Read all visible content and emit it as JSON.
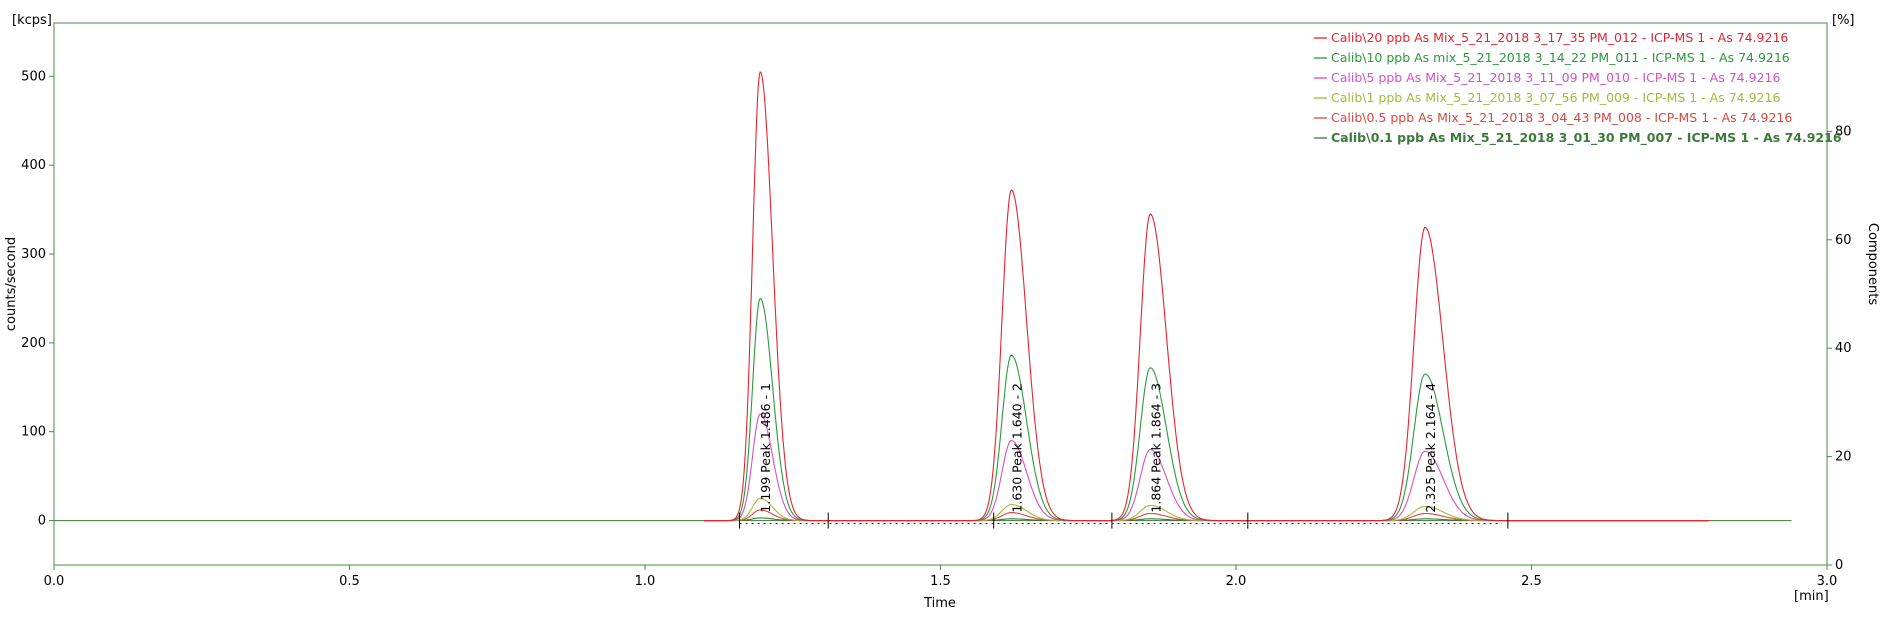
{
  "chart_data": {
    "type": "line",
    "xlabel": "Time",
    "x_unit": "[min]",
    "ylabel": "counts/second",
    "y_unit": "[kcps]",
    "y2label": "Components",
    "y2_unit": "[%]",
    "xlim": [
      0.0,
      3.0
    ],
    "ylim": [
      -50,
      560
    ],
    "y2lim": [
      0,
      100
    ],
    "x_ticks": [
      "0.0",
      "0.5",
      "1.0",
      "1.5",
      "2.0",
      "2.5",
      "3.0"
    ],
    "y_ticks": [
      "0",
      "100",
      "200",
      "300",
      "400",
      "500"
    ],
    "y2_ticks": [
      "0",
      "20",
      "40",
      "60",
      "80"
    ],
    "grid": false,
    "legend_position": "top-right",
    "peaks": [
      {
        "rt": 1.195,
        "label": "1.199 Peak 1.486 - 1",
        "width": 0.013
      },
      {
        "rt": 1.62,
        "label": "1.630 Peak 1.640 - 2",
        "width": 0.016
      },
      {
        "rt": 1.855,
        "label": "1.864 Peak 1.864 - 3",
        "width": 0.017
      },
      {
        "rt": 2.32,
        "label": "2.325 Peak 2.164 - 4",
        "width": 0.019
      }
    ],
    "series": [
      {
        "name": "Calib\\20 ppb As Mix_5_21_2018 3_17_35 PM_012 - ICP-MS 1 - As 74.9216",
        "color": "#e8232f",
        "bold": false,
        "heights": [
          505,
          372,
          345,
          330
        ]
      },
      {
        "name": "Calib\\10 ppb As mix_5_21_2018 3_14_22 PM_011 - ICP-MS 1 - As 74.9216",
        "color": "#2a9a3a",
        "bold": false,
        "heights": [
          250,
          186,
          172,
          165
        ]
      },
      {
        "name": "Calib\\5 ppb  As Mix_5_21_2018 3_11_09 PM_010 - ICP-MS 1 - As 74.9216",
        "color": "#d94fc0",
        "bold": false,
        "heights": [
          120,
          90,
          80,
          78
        ]
      },
      {
        "name": "Calib\\1 ppb As Mix_5_21_2018 3_07_56 PM_009 - ICP-MS 1 - As 74.9216",
        "color": "#a8b83a",
        "bold": false,
        "heights": [
          25,
          18,
          17,
          16
        ]
      },
      {
        "name": "Calib\\0.5 ppb As Mix_5_21_2018 3_04_43 PM_008 - ICP-MS 1 - As 74.9216",
        "color": "#d9473f",
        "bold": false,
        "heights": [
          12,
          9,
          8,
          8
        ]
      },
      {
        "name": "Calib\\0.1 ppb As Mix_5_21_2018 3_01_30 PM_007 - ICP-MS 1 - As 74.9216",
        "color": "#3b7a3a",
        "bold": true,
        "heights": [
          3,
          2,
          2,
          2
        ]
      }
    ],
    "x_end": 2.94,
    "integration_marks": [
      1.16,
      1.31,
      1.59,
      1.79,
      2.02,
      2.46
    ]
  }
}
